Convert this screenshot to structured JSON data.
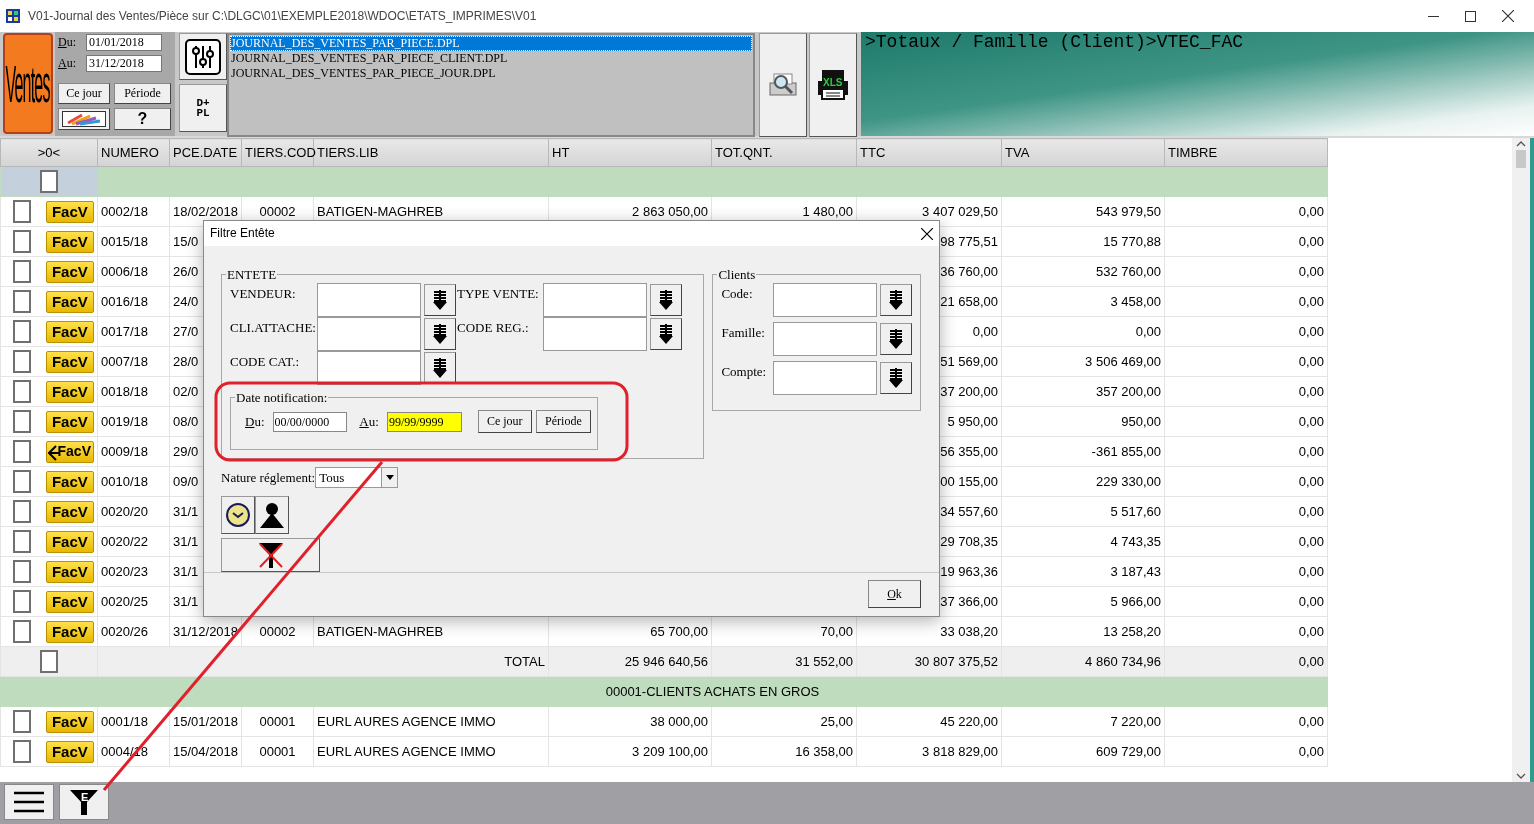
{
  "window": {
    "title": "V01-Journal des Ventes/Pièce sur C:\\DLGC\\01\\EXEMPLE2018\\WDOC\\ETATS_IMPRIMES\\V01"
  },
  "toolbar": {
    "logo": "Ventes",
    "date_from_label": "Du:",
    "date_from": "01/01/2018",
    "date_to_label": "Au:",
    "date_to": "31/12/2018",
    "today_button": "Ce jour",
    "period_button": "Période",
    "help_button": "?",
    "dpl_button": [
      "D+",
      "PL"
    ],
    "xls_label": "XLS",
    "report_files": [
      {
        "name": "JOURNAL_DES_VENTES_PAR_PIECE.DPL",
        "selected": true
      },
      {
        "name": "JOURNAL_DES_VENTES_PAR_PIECE_CLIENT.DPL",
        "selected": false
      },
      {
        "name": "JOURNAL_DES_VENTES_PAR_PIECE_JOUR.DPL",
        "selected": false
      }
    ],
    "path_text": ">Totaux / Famille (Client)>VTEC_FAC"
  },
  "grid": {
    "columns": [
      ">0<",
      "NUMERO",
      "PCE.DATE",
      "TIERS.COD",
      "TIERS.LIB",
      "HT",
      "TOT.QNT.",
      "TTC",
      "TVA",
      "TIMBRE"
    ],
    "rows": [
      {
        "kind": "group",
        "checked": false
      },
      {
        "kind": "doc",
        "checked": false,
        "type": "FacV",
        "cancelled": false,
        "cells": [
          "0002/18",
          "18/02/2018",
          "00002",
          "BATIGEN-MAGHREB",
          "2 863 050,00",
          "1 480,00",
          "3 407 029,50",
          "543 979,50",
          "0,00"
        ]
      },
      {
        "kind": "doc",
        "checked": false,
        "type": "FacV",
        "cancelled": false,
        "cells": [
          "0015/18",
          "15/0",
          null,
          null,
          null,
          null,
          "98 775,51",
          "15 770,88",
          "0,00"
        ]
      },
      {
        "kind": "doc",
        "checked": false,
        "type": "FacV",
        "cancelled": false,
        "cells": [
          "0006/18",
          "26/0",
          null,
          null,
          null,
          null,
          "36 760,00",
          "532 760,00",
          "0,00"
        ]
      },
      {
        "kind": "doc",
        "checked": false,
        "type": "FacV",
        "cancelled": false,
        "cells": [
          "0016/18",
          "24/0",
          null,
          null,
          null,
          null,
          "21 658,00",
          "3 458,00",
          "0,00"
        ]
      },
      {
        "kind": "doc",
        "checked": false,
        "type": "FacV",
        "cancelled": false,
        "cells": [
          "0017/18",
          "27/0",
          null,
          null,
          null,
          null,
          "0,00",
          "0,00",
          "0,00"
        ]
      },
      {
        "kind": "doc",
        "checked": false,
        "type": "FacV",
        "cancelled": false,
        "cells": [
          "0007/18",
          "28/0",
          null,
          null,
          null,
          null,
          "51 569,00",
          "3 506 469,00",
          "0,00"
        ]
      },
      {
        "kind": "doc",
        "checked": false,
        "type": "FacV",
        "cancelled": false,
        "cells": [
          "0018/18",
          "02/0",
          null,
          null,
          null,
          null,
          "37 200,00",
          "357 200,00",
          "0,00"
        ]
      },
      {
        "kind": "doc",
        "checked": false,
        "type": "FacV",
        "cancelled": false,
        "cells": [
          "0019/18",
          "08/0",
          null,
          null,
          null,
          null,
          "5 950,00",
          "950,00",
          "0,00"
        ]
      },
      {
        "kind": "doc",
        "checked": false,
        "type": "FacV",
        "cancelled": true,
        "cells": [
          "0009/18",
          "29/0",
          null,
          null,
          null,
          null,
          "56 355,00",
          "-361 855,00",
          "0,00"
        ]
      },
      {
        "kind": "doc",
        "checked": false,
        "type": "FacV",
        "cancelled": false,
        "cells": [
          "0010/18",
          "09/0",
          null,
          null,
          null,
          null,
          "00 155,00",
          "229 330,00",
          "0,00"
        ]
      },
      {
        "kind": "doc",
        "checked": false,
        "type": "FacV",
        "cancelled": false,
        "cells": [
          "0020/20",
          "31/1",
          null,
          null,
          null,
          null,
          "34 557,60",
          "5 517,60",
          "0,00"
        ]
      },
      {
        "kind": "doc",
        "checked": false,
        "type": "FacV",
        "cancelled": false,
        "cells": [
          "0020/22",
          "31/1",
          null,
          null,
          null,
          null,
          "29 708,35",
          "4 743,35",
          "0,00"
        ]
      },
      {
        "kind": "doc",
        "checked": false,
        "type": "FacV",
        "cancelled": false,
        "cells": [
          "0020/23",
          "31/1",
          null,
          null,
          null,
          null,
          "19 963,36",
          "3 187,43",
          "0,00"
        ]
      },
      {
        "kind": "doc",
        "checked": false,
        "type": "FacV",
        "cancelled": false,
        "cells": [
          "0020/25",
          "31/1",
          null,
          null,
          null,
          null,
          "37 366,00",
          "5 966,00",
          "0,00"
        ]
      },
      {
        "kind": "doc",
        "checked": false,
        "type": "FacV",
        "cancelled": false,
        "cells": [
          "0020/26",
          "31/12/2018",
          "00002",
          "BATIGEN-MAGHREB",
          "65 700,00",
          "70,00",
          "33 038,20",
          "13 258,20",
          "0,00"
        ]
      },
      {
        "kind": "total",
        "checked": false,
        "label": "TOTAL",
        "cells": [
          "25 946 640,56",
          "31 552,00",
          "30 807 375,52",
          "4 860 734,96",
          "0,00"
        ]
      },
      {
        "kind": "group",
        "label": "00001-CLIENTS ACHATS EN GROS"
      },
      {
        "kind": "doc",
        "checked": false,
        "type": "FacV",
        "cancelled": false,
        "cells": [
          "0001/18",
          "15/01/2018",
          "00001",
          "EURL AURES AGENCE IMMO",
          "38 000,00",
          "25,00",
          "45 220,00",
          "7 220,00",
          "0,00"
        ]
      },
      {
        "kind": "doc",
        "checked": false,
        "type": "FacV",
        "cancelled": false,
        "cells": [
          "0004/18",
          "15/04/2018",
          "00001",
          "EURL AURES AGENCE IMMO",
          "3 209 100,00",
          "16 358,00",
          "3 818 829,00",
          "609 729,00",
          "0,00"
        ]
      }
    ]
  },
  "bottom_bar": {
    "filter_letter": "E"
  },
  "dialog": {
    "title": "Filtre Entête",
    "entete": {
      "legend": "ENTETE",
      "left_fields": [
        {
          "label": "VENDEUR:"
        },
        {
          "label": "CLI.ATTACHE:"
        },
        {
          "label": "CODE CAT.:"
        }
      ],
      "right_fields": [
        {
          "label": "TYPE VENTE:"
        },
        {
          "label": "CODE REG.:"
        }
      ]
    },
    "date_notification": {
      "legend": "Date notification:",
      "from_label": "Du:",
      "from": "00/00/0000",
      "to_label": "Au:",
      "to": "99/99/9999",
      "to_focused": true,
      "today_button": "Ce jour",
      "period_button": "Période"
    },
    "clients": {
      "legend": "Clients",
      "fields": [
        {
          "label": "Code:"
        },
        {
          "label": "Famille:"
        },
        {
          "label": "Compte:"
        }
      ]
    },
    "payment": {
      "label": "Nature réglement:",
      "value": "Tous"
    },
    "ok_button": "Ok"
  }
}
